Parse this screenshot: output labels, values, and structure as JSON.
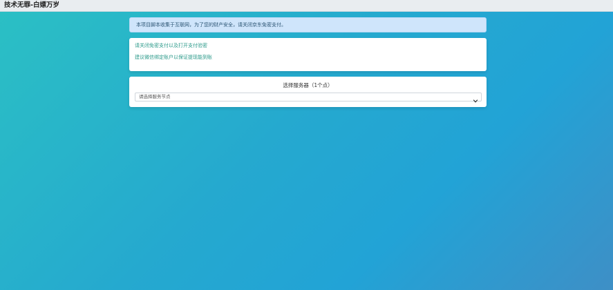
{
  "header": {
    "title": "技术无罪-白嫖万岁"
  },
  "notice": {
    "text": "本项目脚本收集于互联网，为了您的财产安全，请关闭京东免密支付。"
  },
  "tips": {
    "items": [
      "请关闭免密支付以及打开支付验密",
      "建议微信绑定账户以保证提现能到账"
    ]
  },
  "service": {
    "label": "选择服务器（1个点）",
    "selected": "请选择服务节点",
    "icons": {
      "dropdown": "chevron-down-icon"
    }
  },
  "colors": {
    "background_start": "#2bc0c4",
    "background_end": "#3e8fc6",
    "alert_bg": "#cfe5fb",
    "tip_text": "#2b9a8a"
  }
}
